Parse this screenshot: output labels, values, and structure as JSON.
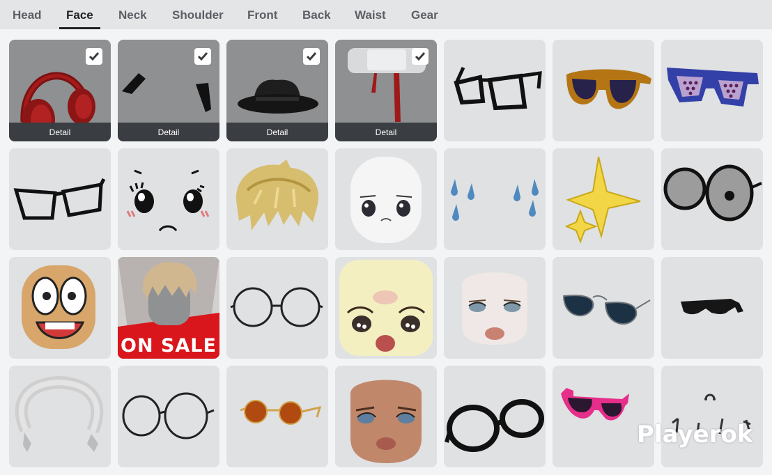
{
  "tabs": [
    {
      "label": "Head"
    },
    {
      "label": "Face"
    },
    {
      "label": "Neck"
    },
    {
      "label": "Shoulder"
    },
    {
      "label": "Front"
    },
    {
      "label": "Back"
    },
    {
      "label": "Waist"
    },
    {
      "label": "Gear"
    }
  ],
  "active_tab": "Face",
  "tiles": {
    "detail_label": "Detail",
    "sale_label": "ON SALE"
  },
  "watermark": "Playerok",
  "colors": {
    "tab_bar": "#e3e5e7",
    "tile_bg": "#dfe1e3",
    "equipped_tile_bg": "#8e9092",
    "detail_bar": "#3a3d41",
    "sale_red": "#d9161c"
  }
}
